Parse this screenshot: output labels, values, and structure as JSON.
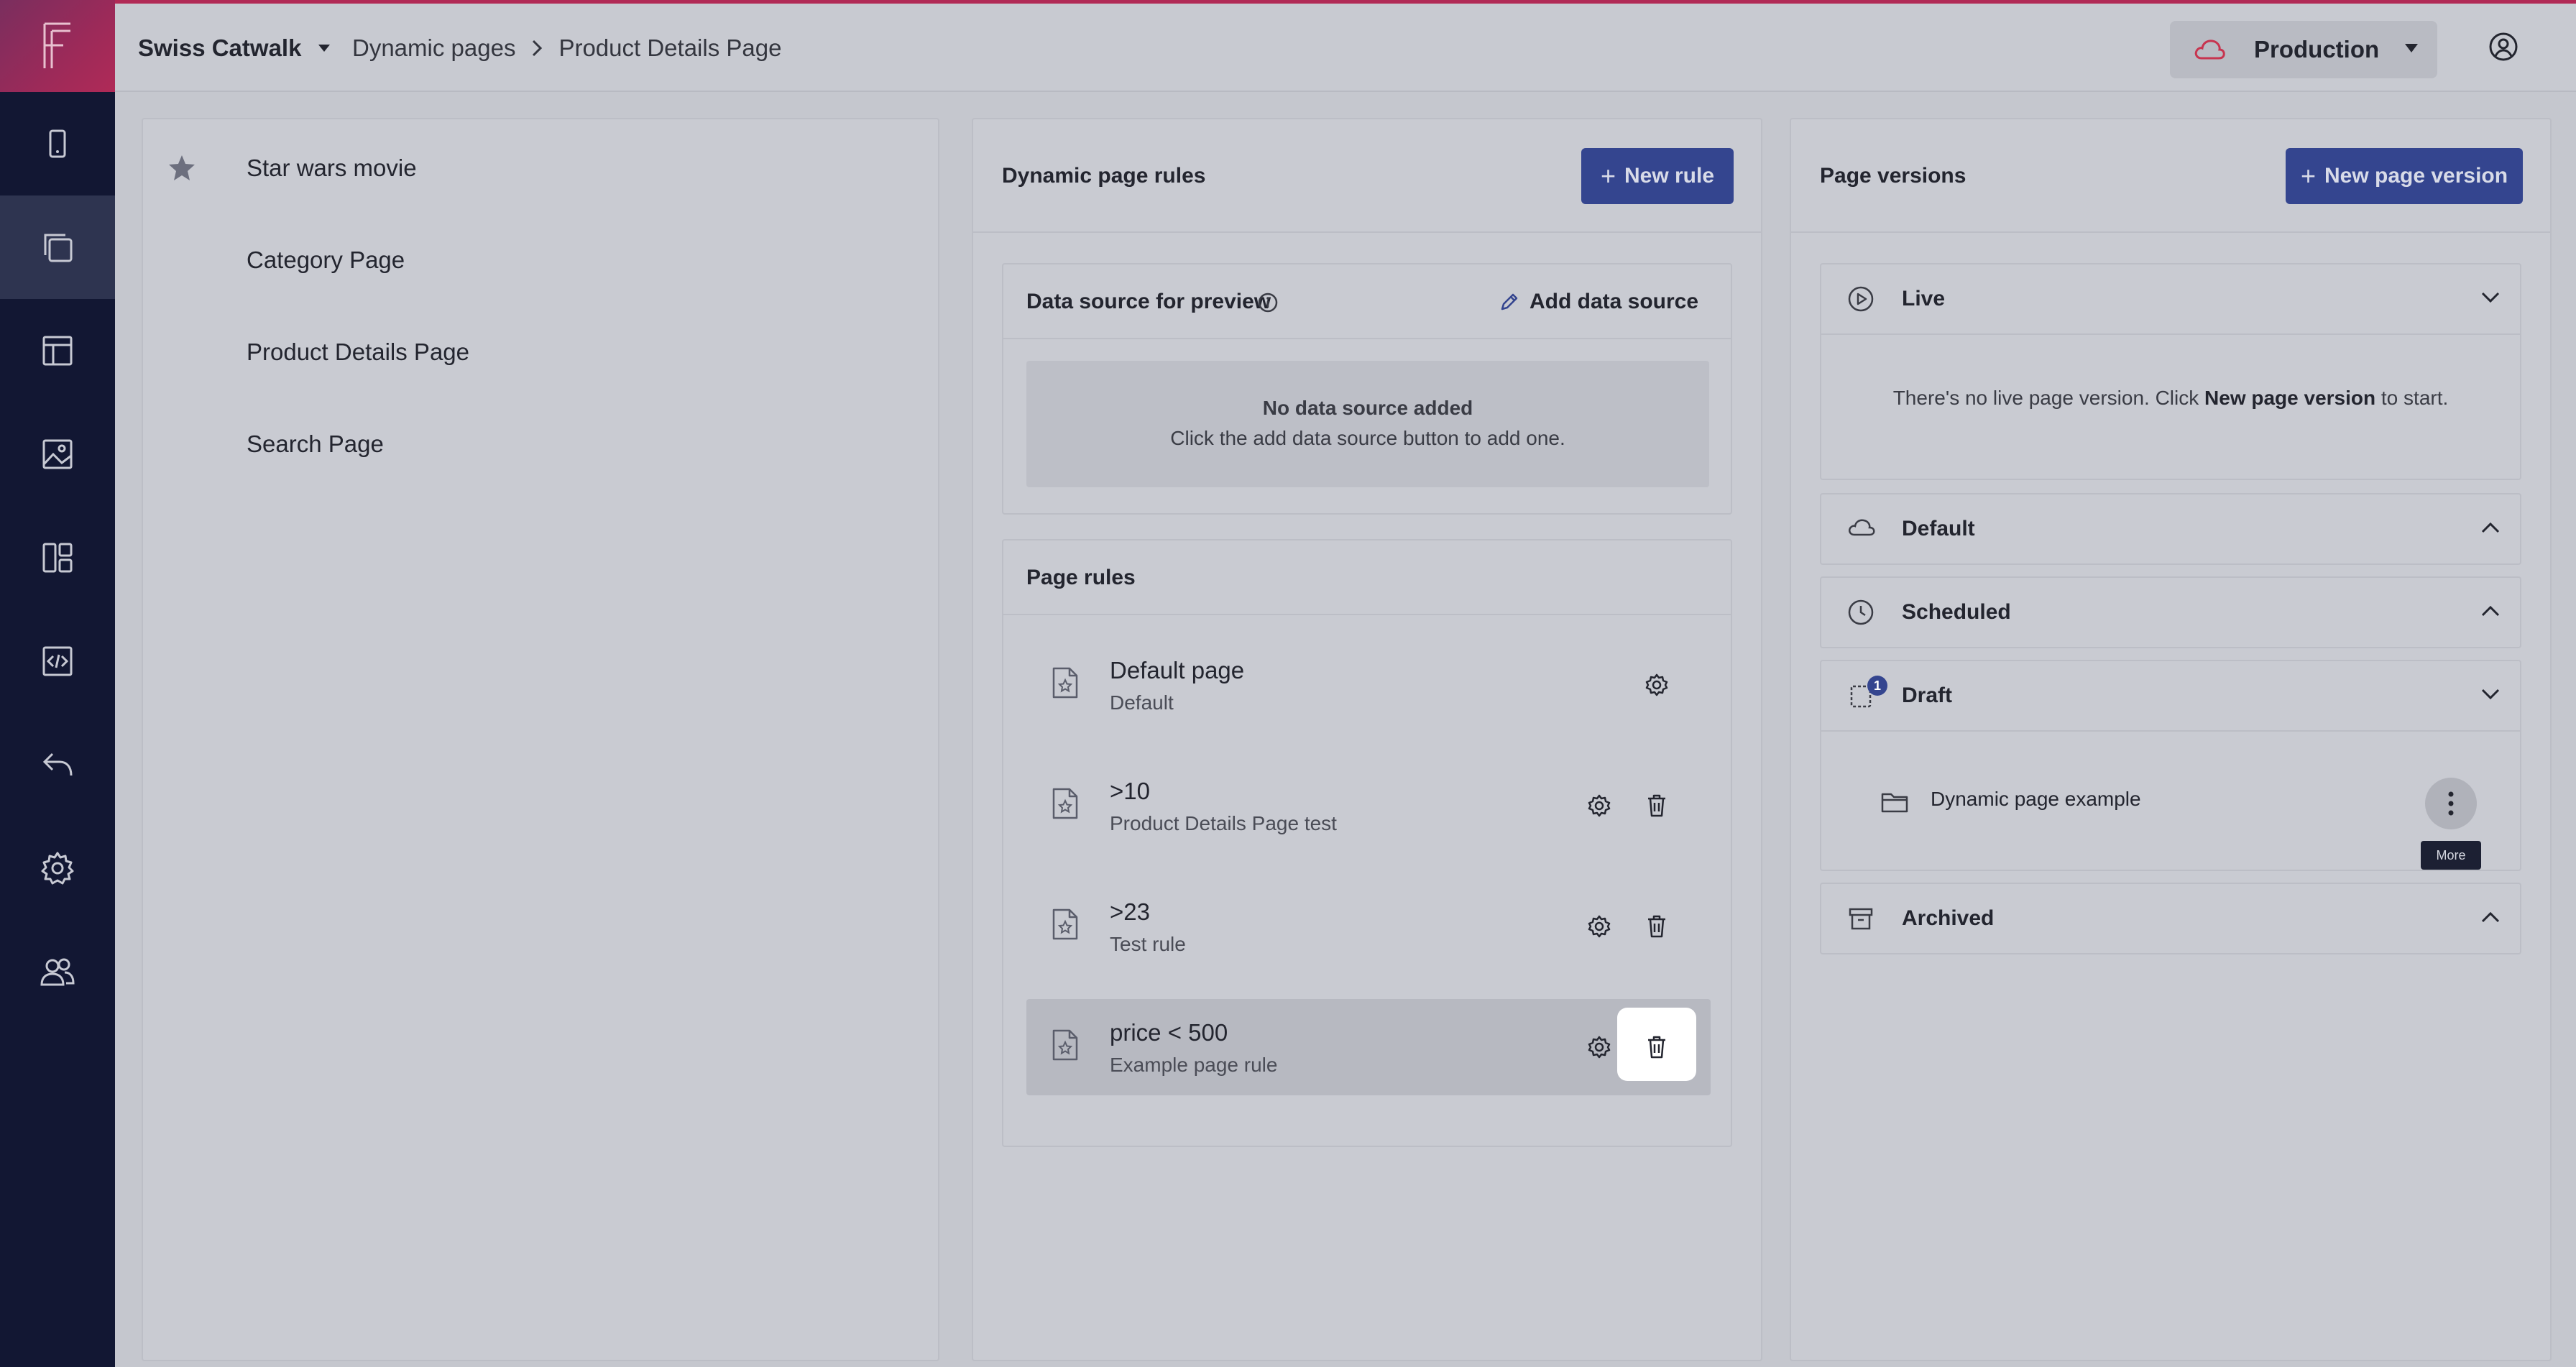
{
  "app": {
    "project": "Swiss Catwalk",
    "breadcrumb": [
      "Dynamic pages",
      "Product Details Page"
    ],
    "environment": "Production"
  },
  "sidebar": {
    "items": [
      "mobile-icon",
      "pages-icon",
      "layout-icon",
      "image-icon",
      "dashboard-icon",
      "code-icon",
      "undo-icon",
      "settings-icon",
      "users-icon"
    ],
    "active_index": 1
  },
  "pages": {
    "items": [
      {
        "label": "Star wars movie",
        "starred": true
      },
      {
        "label": "Category Page",
        "starred": false
      },
      {
        "label": "Product Details Page",
        "starred": false
      },
      {
        "label": "Search Page",
        "starred": false
      }
    ]
  },
  "rules": {
    "title": "Dynamic page rules",
    "new_rule": "New rule",
    "data_source": {
      "title": "Data source for preview",
      "add_label": "Add data source",
      "empty_title": "No data source added",
      "empty_text": "Click the add data source button to add one."
    },
    "page_rules": {
      "title": "Page rules",
      "items": [
        {
          "name": "Default page",
          "sub": "Default"
        },
        {
          "name": ">10",
          "sub": "Product Details Page test"
        },
        {
          "name": ">23",
          "sub": "Test rule"
        },
        {
          "name": "price < 500",
          "sub": "Example page rule"
        }
      ]
    }
  },
  "versions": {
    "title": "Page versions",
    "new_version": "New page version",
    "live": {
      "title": "Live",
      "msg_pre": "There's no live page version. Click ",
      "msg_bold": "New page version",
      "msg_post": " to start."
    },
    "default_title": "Default",
    "scheduled_title": "Scheduled",
    "draft": {
      "title": "Draft",
      "count": "1",
      "item": "Dynamic page example",
      "more_tooltip": "More"
    },
    "archived_title": "Archived"
  },
  "colors": {
    "sidebar": "#121733",
    "accent": "#b12a56",
    "primary": "#34458f"
  }
}
